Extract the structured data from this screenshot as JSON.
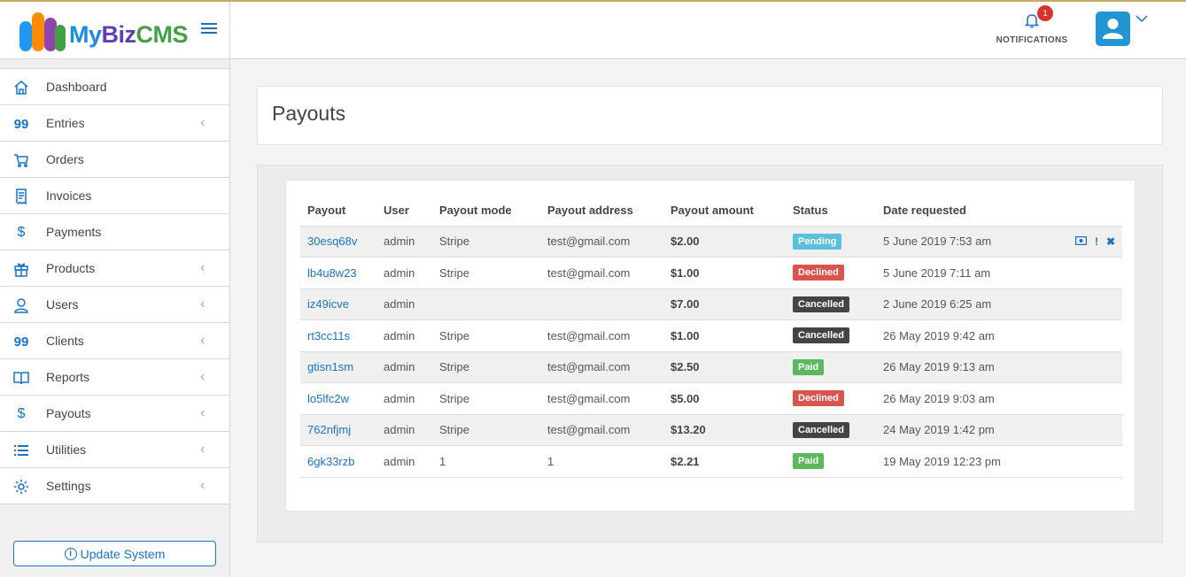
{
  "app": {
    "logo": {
      "my": "My",
      "biz": "Biz",
      "cms": "CMS"
    }
  },
  "sidebar": {
    "items": [
      {
        "label": "Dashboard",
        "icon": "home-icon",
        "has_children": false
      },
      {
        "label": "Entries",
        "icon": "quote-icon",
        "has_children": true
      },
      {
        "label": "Orders",
        "icon": "cart-icon",
        "has_children": false
      },
      {
        "label": "Invoices",
        "icon": "invoice-icon",
        "has_children": false
      },
      {
        "label": "Payments",
        "icon": "dollar-icon",
        "has_children": false
      },
      {
        "label": "Products",
        "icon": "gift-icon",
        "has_children": true
      },
      {
        "label": "Users",
        "icon": "user-icon",
        "has_children": true
      },
      {
        "label": "Clients",
        "icon": "quote-icon",
        "has_children": true
      },
      {
        "label": "Reports",
        "icon": "book-icon",
        "has_children": true
      },
      {
        "label": "Payouts",
        "icon": "dollar-icon",
        "has_children": true
      },
      {
        "label": "Utilities",
        "icon": "list-icon",
        "has_children": true
      },
      {
        "label": "Settings",
        "icon": "gear-icon",
        "has_children": true
      }
    ],
    "update_button": "Update System"
  },
  "topbar": {
    "notifications_label": "NOTIFICATIONS",
    "notifications_count": "1"
  },
  "page": {
    "title": "Payouts",
    "table": {
      "columns": [
        "Payout",
        "User",
        "Payout mode",
        "Payout address",
        "Payout amount",
        "Status",
        "Date requested"
      ],
      "rows": [
        {
          "id": "30esq68v",
          "user": "admin",
          "mode": "Stripe",
          "address": "test@gmail.com",
          "amount": "$2.00",
          "status": "Pending",
          "date": "5 June 2019 7:53 am"
        },
        {
          "id": "lb4u8w23",
          "user": "admin",
          "mode": "Stripe",
          "address": "test@gmail.com",
          "amount": "$1.00",
          "status": "Declined",
          "date": "5 June 2019 7:11 am"
        },
        {
          "id": "iz49icve",
          "user": "admin",
          "mode": "",
          "address": "",
          "amount": "$7.00",
          "status": "Cancelled",
          "date": "2 June 2019 6:25 am"
        },
        {
          "id": "rt3cc11s",
          "user": "admin",
          "mode": "Stripe",
          "address": "test@gmail.com",
          "amount": "$1.00",
          "status": "Cancelled",
          "date": "26 May 2019 9:42 am"
        },
        {
          "id": "gtisn1sm",
          "user": "admin",
          "mode": "Stripe",
          "address": "test@gmail.com",
          "amount": "$2.50",
          "status": "Paid",
          "date": "26 May 2019 9:13 am"
        },
        {
          "id": "lo5lfc2w",
          "user": "admin",
          "mode": "Stripe",
          "address": "test@gmail.com",
          "amount": "$5.00",
          "status": "Declined",
          "date": "26 May 2019 9:03 am"
        },
        {
          "id": "762nfjmj",
          "user": "admin",
          "mode": "Stripe",
          "address": "test@gmail.com",
          "amount": "$13.20",
          "status": "Cancelled",
          "date": "24 May 2019 1:42 pm"
        },
        {
          "id": "6gk33rzb",
          "user": "admin",
          "mode": "1",
          "address": "1",
          "amount": "$2.21",
          "status": "Paid",
          "date": "19 May 2019 12:23 pm"
        }
      ],
      "row_actions": [
        "pay-icon",
        "exclamation-icon",
        "close-icon"
      ]
    }
  },
  "colors": {
    "accent": "#1a73c9",
    "status_pending": "#5bc0de",
    "status_declined": "#d9534f",
    "status_cancelled": "#444444",
    "status_paid": "#5cb85c"
  }
}
